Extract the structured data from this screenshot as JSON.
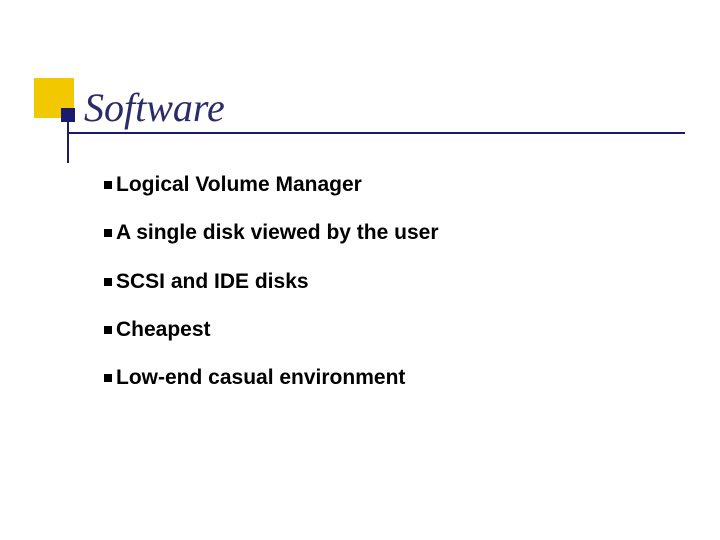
{
  "title": "Software",
  "bullets": [
    "Logical Volume Manager",
    "A single disk viewed by the user",
    "SCSI and IDE disks",
    "Cheapest",
    "Low-end casual environment"
  ]
}
